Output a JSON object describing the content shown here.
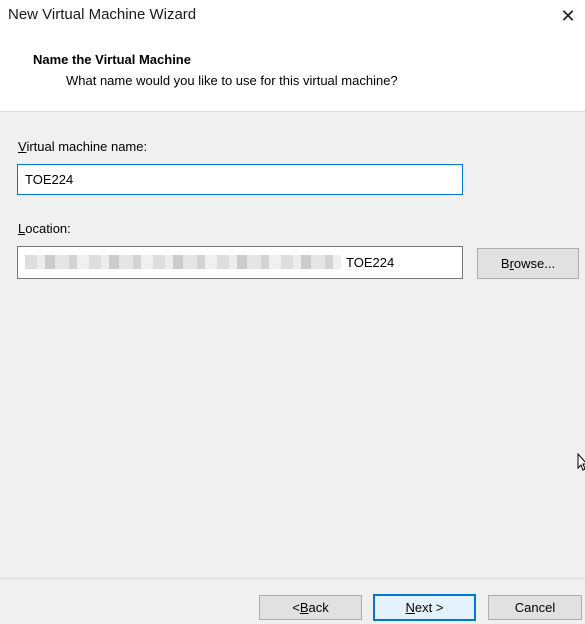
{
  "window": {
    "title": "New Virtual Machine Wizard",
    "close_glyph": "✕"
  },
  "header": {
    "title": "Name the Virtual Machine",
    "subtitle": "What name would you like to use for this virtual machine?"
  },
  "form": {
    "vm_name_label_hotkey": "V",
    "vm_name_label_rest": "irtual machine name:",
    "vm_name_value": "TOE224",
    "location_label_hotkey": "L",
    "location_label_rest": "ocation:",
    "location_value_visible": "TOE224",
    "browse_label_pre": "B",
    "browse_label_hotkey": "r",
    "browse_label_post": "owse..."
  },
  "footer": {
    "back_pre": "< ",
    "back_hotkey": "B",
    "back_post": "ack",
    "next_hotkey": "N",
    "next_post": "ext >",
    "cancel_label": "Cancel"
  }
}
